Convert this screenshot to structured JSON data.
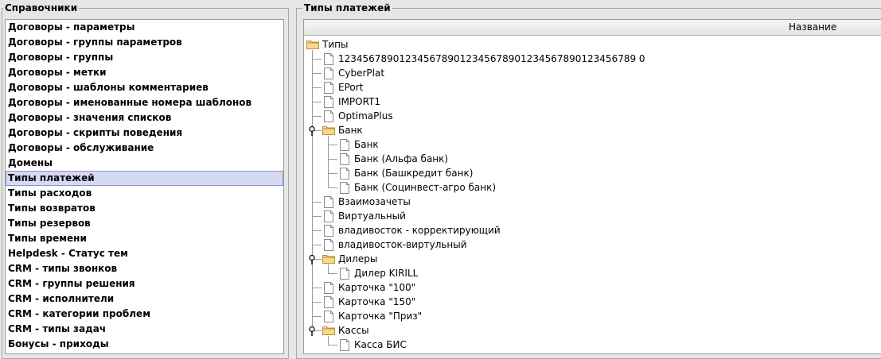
{
  "left_panel": {
    "title": "Справочники",
    "selected_index": 10,
    "items": [
      "Договоры - параметры",
      "Договоры - группы параметров",
      "Договоры - группы",
      "Договоры - метки",
      "Договоры - шаблоны комментариев",
      "Договоры - именованные номера шаблонов",
      "Договоры - значения списков",
      "Договоры - скрипты поведения",
      "Договоры - обслуживание",
      "Домены",
      "Типы платежей",
      "Типы расходов",
      "Типы возвратов",
      "Типы резервов",
      "Типы времени",
      "Helpdesk - Статус тем",
      "CRM - типы звонков",
      "CRM - группы решения",
      "CRM - исполнители",
      "CRM - категории проблем",
      "CRM - типы задач",
      "Бонусы - приходы"
    ]
  },
  "right_panel": {
    "title": "Типы платежей",
    "column_header": "Название",
    "tree": [
      {
        "label": "Типы",
        "level": 0,
        "type": "folder",
        "expanded": true
      },
      {
        "label": "1234567890123456789012345678901234567890123456789 0",
        "level": 1,
        "type": "leaf"
      },
      {
        "label": "CyberPlat",
        "level": 1,
        "type": "leaf"
      },
      {
        "label": "EPort",
        "level": 1,
        "type": "leaf"
      },
      {
        "label": "IMPORT1",
        "level": 1,
        "type": "leaf"
      },
      {
        "label": "OptimaPlus",
        "level": 1,
        "type": "leaf"
      },
      {
        "label": "Банк",
        "level": 1,
        "type": "folder",
        "expanded": true
      },
      {
        "label": "Банк",
        "level": 2,
        "type": "leaf"
      },
      {
        "label": "Банк (Альфа банк)",
        "level": 2,
        "type": "leaf"
      },
      {
        "label": "Банк (Башкредит банк)",
        "level": 2,
        "type": "leaf"
      },
      {
        "label": "Банк (Социнвест-агро банк)",
        "level": 2,
        "type": "leaf"
      },
      {
        "label": "Взаимозачеты",
        "level": 1,
        "type": "leaf"
      },
      {
        "label": "Виртуальный",
        "level": 1,
        "type": "leaf"
      },
      {
        "label": "владивосток - корректирующий",
        "level": 1,
        "type": "leaf"
      },
      {
        "label": "владивосток-виртульный",
        "level": 1,
        "type": "leaf"
      },
      {
        "label": "Дилеры",
        "level": 1,
        "type": "folder",
        "expanded": true
      },
      {
        "label": "Дилер KIRILL",
        "level": 2,
        "type": "leaf"
      },
      {
        "label": "Карточка \"100\"",
        "level": 1,
        "type": "leaf"
      },
      {
        "label": "Карточка \"150\"",
        "level": 1,
        "type": "leaf"
      },
      {
        "label": "Карточка \"Приз\"",
        "level": 1,
        "type": "leaf"
      },
      {
        "label": "Кассы",
        "level": 1,
        "type": "folder",
        "expanded": true
      },
      {
        "label": "Касса БИС",
        "level": 2,
        "type": "leaf"
      }
    ]
  }
}
